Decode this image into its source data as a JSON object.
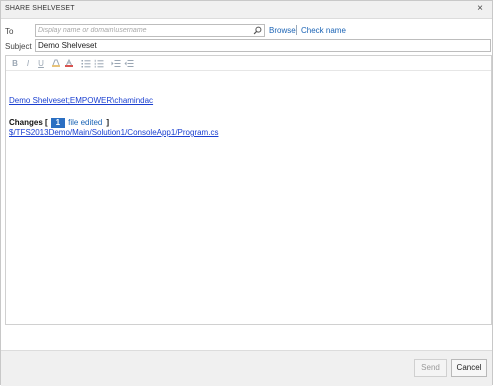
{
  "window": {
    "title": "SHARE SHELVESET",
    "close_symbol": "×"
  },
  "to": {
    "label": "To",
    "placeholder": "Display name or domain\\username",
    "value": "",
    "browse_label": "Browse",
    "check_name_label": "Check name"
  },
  "subject": {
    "label": "Subject",
    "value": "Demo Shelveset"
  },
  "toolbar": {
    "bold_label": "B",
    "italic_label": "I",
    "underline_label": "U",
    "buttons": [
      "bold",
      "italic",
      "underline",
      "highlight",
      "font-color",
      "bulleted-list",
      "numbered-list",
      "indent",
      "outdent"
    ]
  },
  "body": {
    "shelveset_link": "Demo Shelveset;EMPOWER\\chamindac",
    "changes_label": "Changes [",
    "changes_close": "]",
    "file_count": "1",
    "file_edited_label": "file edited",
    "file_path": "$/TFS2013Demo/Main/Solution1/ConsoleApp1/Program.cs"
  },
  "footer": {
    "send_label": "Send",
    "cancel_label": "Cancel"
  },
  "colors": {
    "link": "#1a63b5",
    "body_link": "#1a3fd0",
    "badge": "#2b6fc2",
    "titlebar": "#f0f0f0"
  }
}
